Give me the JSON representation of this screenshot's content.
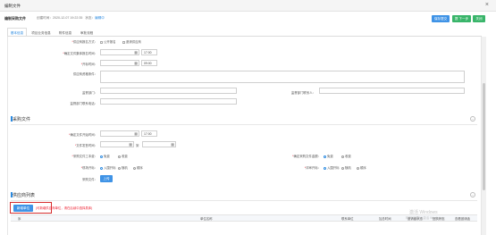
{
  "window": {
    "title": "编制文件",
    "close": "×"
  },
  "doc": {
    "name": "编制采购文件",
    "created_label": "创建时间：",
    "created": "2020-12-07 19:22:35",
    "status_label": "状态：",
    "status": "编辑中"
  },
  "toolbar": {
    "save": "保存提交",
    "next": "提 下一步",
    "close": "关闭"
  },
  "tabs": [
    "基本信息",
    "项目业务信息",
    "附件信息",
    "审批流程"
  ],
  "form": {
    "row1_label": "供应商报名方式：",
    "row1_opt1": "公开报名",
    "row1_opt2": "邀请供应商",
    "row2_label": "确定文件集体报名时间：",
    "row2_time": "17:00",
    "row3_label": "开标时间：",
    "row3_time": "09:00",
    "row4_label": "供应商资格条件：",
    "row5_label": "监督部门：",
    "row5b_label": "监督部门联系人：",
    "row6_label": "监督部门联系电话："
  },
  "section_files": {
    "title": "采购文件"
  },
  "files": {
    "f1_label": "确定文件开始时间：",
    "f1_time": "17:00",
    "f2_label": "文件发售时间：",
    "f2_sep": "到",
    "f3_label": "采购文件工本费：",
    "f3_opt1": "免费",
    "f3_opt2": "收费",
    "f3b_label": "确定采购文件金额：",
    "f3b_opt1": "免费",
    "f3b_opt2": "收费",
    "f4_label": "现场开标：",
    "f4_opt1": "入围开标",
    "f4_opt2": "随机",
    "f4_opt3": "顺序",
    "f4b_label": "评审开标：",
    "f4b_opt1": "入围开标",
    "f4b_opt2": "随机",
    "f4b_opt3": "顺序",
    "f5_label": "采购文件：",
    "f5_btn": "上传"
  },
  "section_suppliers": {
    "title": "供应商列表"
  },
  "suppliers": {
    "add_btn": "新增单位",
    "hint": "(可新增供应商单位，请在后续中选择具体)",
    "columns": [
      "序",
      "单位名称",
      "联系单位",
      "加总时间",
      "邀请函状态",
      "回执状态",
      "查看邀请函"
    ]
  },
  "watermark": {
    "line1": "激活 Windows",
    "line2": "转到\"设置\"以激活 Windows。"
  },
  "colors": {
    "accent": "#2b8ae0",
    "primary_btn": "#3f93e6",
    "next_btn": "#39b56a",
    "highlight": "#d62d2d"
  }
}
